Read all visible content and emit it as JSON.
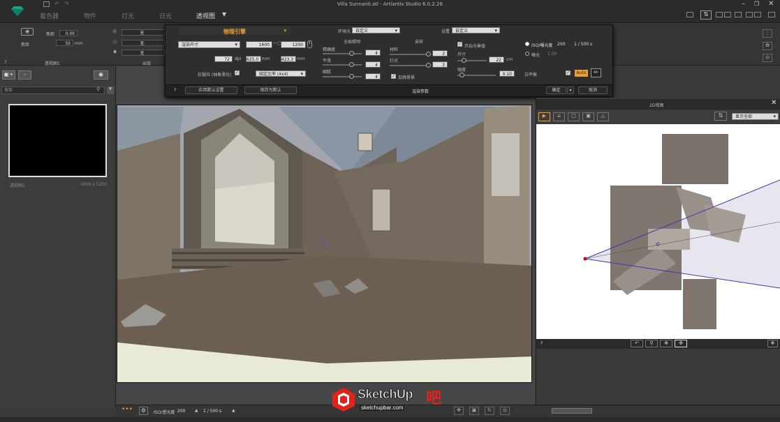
{
  "app": {
    "title": "Villa Sunnanö.atl - Artlantis Studio 6.0.2.26",
    "tabs": [
      "着色器",
      "物件",
      "灯光",
      "日光",
      "透视图"
    ],
    "active_tab": 4
  },
  "left_tools": {
    "row1_label": "焦距",
    "row1_value": "0.00",
    "row2_label": "焦距",
    "row2_value": "50",
    "row2_unit": "mm",
    "footer_number": "7",
    "footer_label": "透视图1",
    "light_footer": "出现",
    "light_values": [
      "无",
      "无",
      "无"
    ]
  },
  "left_panel": {
    "search_placeholder": "搜索",
    "thumb_label": "透视图1",
    "thumb_size": "1600 x 1200"
  },
  "render_dialog": {
    "engine": "物理引擎",
    "preset_label": "渲染尺寸",
    "width": "1600",
    "height": "1200",
    "dpi": "72",
    "dpi_unit": "dpi",
    "width_mm": "625.0",
    "height_mm": "423.3",
    "mm": "mm",
    "antialias_label": "抗锯齿 (抽象柔化)",
    "ratio_label": "固定比率 (4x4)",
    "global_label": "环境光",
    "global_sel": "自定义",
    "quality_label": "全局照明",
    "q_rows": [
      {
        "label": "精确度",
        "value": "4"
      },
      {
        "label": "平滑",
        "value": "4"
      },
      {
        "label": "细腻",
        "value": "4"
      }
    ],
    "shadow_title": "采样",
    "s_rows": [
      {
        "label": "材料",
        "value": "3"
      },
      {
        "label": "灯光",
        "value": "3"
      }
    ],
    "shadow_chk": "加强背景",
    "lighting_label": "设置",
    "lighting_sel": "自定义",
    "glow_chk": "开启光晕值",
    "size_label": "尺寸",
    "size_value": "22",
    "size_unit": "cm",
    "intensity_label": "强度",
    "intensity_value": "0.10",
    "iso_label": "ISO/曝光度",
    "iso_value": "200",
    "shutter": "1 / 500 s",
    "exposure_label": "曝光",
    "exposure_value": "1.00",
    "white_balance": "白平衡",
    "auto": "Auto",
    "help": "?",
    "btn_apply_default": "应用默认设置",
    "btn_save_default": "保存为默认",
    "footer_title": "渲染参数",
    "btn_ok": "确定",
    "btn_cancel": "取消"
  },
  "view2d": {
    "title": "2D视图",
    "show_all": "显示全部",
    "help": "?"
  },
  "bottom_bar": {
    "iso_label": "ISO/感光度",
    "iso_value": "200",
    "shutter": "1 / 500 s"
  },
  "watermark": {
    "brand": "SketchUp",
    "brand2": "吧",
    "url": "sketchupbar.com"
  }
}
